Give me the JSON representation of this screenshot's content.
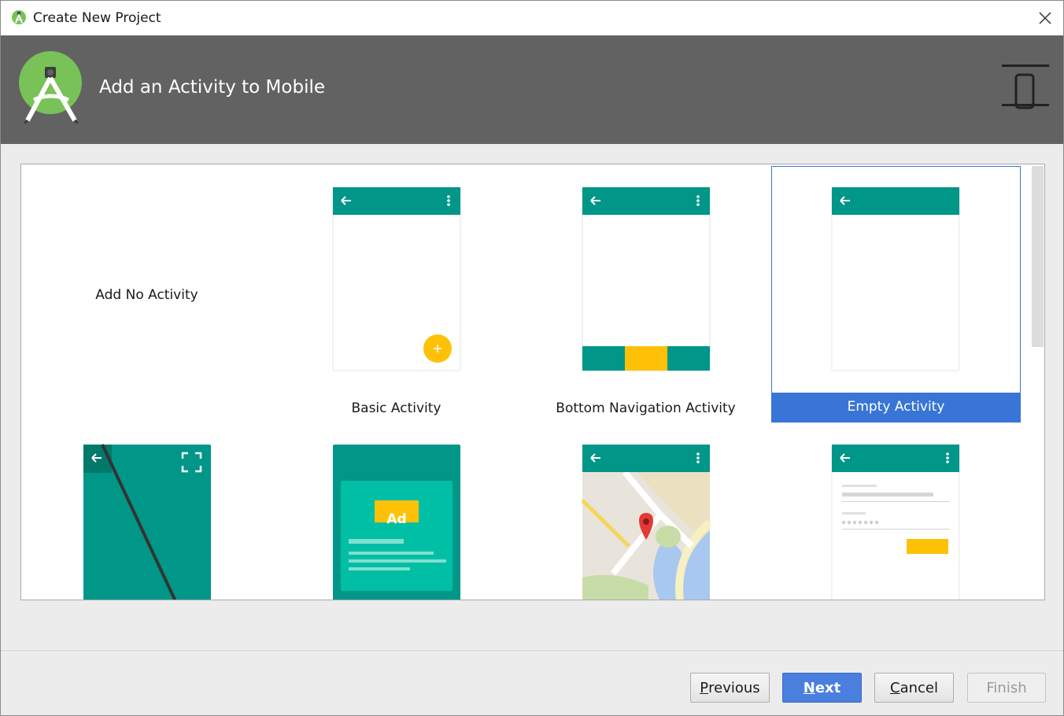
{
  "window": {
    "title": "Create New Project"
  },
  "header": {
    "title": "Add an Activity to Mobile"
  },
  "gallery": {
    "items": [
      {
        "label": "Add No Activity",
        "selected": false
      },
      {
        "label": "Basic Activity",
        "selected": false
      },
      {
        "label": "Bottom Navigation Activity",
        "selected": false
      },
      {
        "label": "Empty Activity",
        "selected": true
      },
      {
        "label": "",
        "selected": false
      },
      {
        "label": "",
        "selected": false
      },
      {
        "label": "",
        "selected": false
      },
      {
        "label": "",
        "selected": false
      }
    ],
    "ad_badge": "Ad"
  },
  "footer": {
    "previous_first": "P",
    "previous_rest": "revious",
    "next_first": "N",
    "next_rest": "ext",
    "cancel_first": "C",
    "cancel_rest": "ancel",
    "finish_label": "Finish"
  },
  "colors": {
    "teal": "#009688",
    "accent_yellow": "#FFC107",
    "selection_blue": "#3875D7",
    "header_gray": "#626262",
    "android_green": "#78C257"
  },
  "icons": [
    "android-studio-icon",
    "close-icon",
    "android-studio-logo",
    "device-icon",
    "back-arrow-icon",
    "overflow-menu-icon",
    "fab-plus-icon",
    "fullscreen-icon",
    "map-pin-icon"
  ]
}
